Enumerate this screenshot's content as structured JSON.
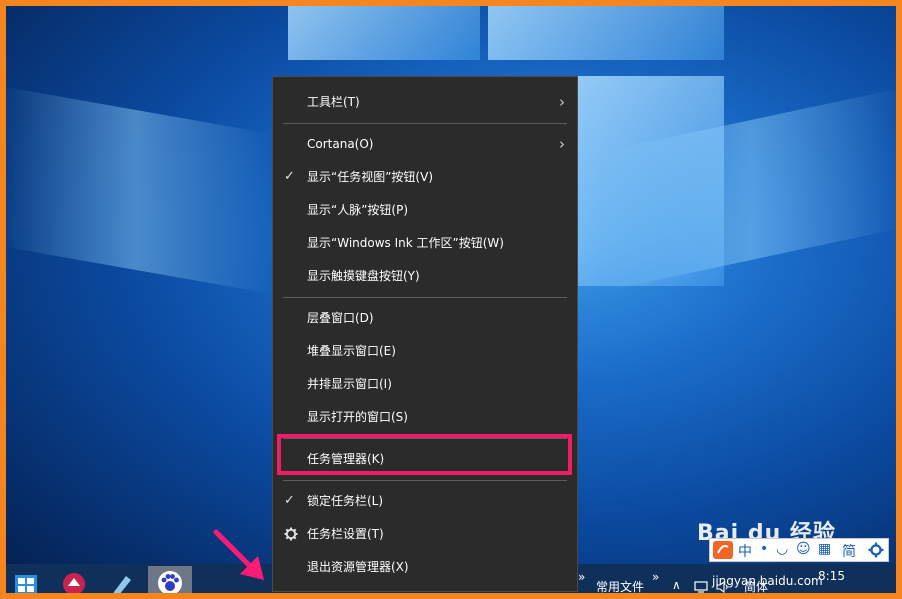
{
  "menu": {
    "items": [
      {
        "label": "工具栏(T)",
        "checked": false,
        "submenu": true
      },
      {
        "label": "Cortana(O)",
        "checked": false,
        "submenu": true
      },
      {
        "label": "显示“任务视图”按钮(V)",
        "checked": true,
        "submenu": false
      },
      {
        "label": "显示“人脉”按钮(P)",
        "checked": false,
        "submenu": false
      },
      {
        "label": "显示“Windows Ink 工作区”按钮(W)",
        "checked": false,
        "submenu": false
      },
      {
        "label": "显示触摸键盘按钮(Y)",
        "checked": false,
        "submenu": false
      },
      {
        "label": "层叠窗口(D)",
        "checked": false,
        "submenu": false
      },
      {
        "label": "堆叠显示窗口(E)",
        "checked": false,
        "submenu": false
      },
      {
        "label": "并排显示窗口(I)",
        "checked": false,
        "submenu": false
      },
      {
        "label": "显示打开的窗口(S)",
        "checked": false,
        "submenu": false
      },
      {
        "label": "任务管理器(K)",
        "checked": false,
        "submenu": false,
        "highlighted": true
      },
      {
        "label": "锁定任务栏(L)",
        "checked": true,
        "submenu": false
      },
      {
        "label": "任务栏设置(T)",
        "checked": false,
        "submenu": false,
        "icon": "gear-icon"
      },
      {
        "label": "退出资源管理器(X)",
        "checked": false,
        "submenu": false
      }
    ],
    "check_glyph": "✓",
    "chevron_glyph": "›"
  },
  "taskbar": {
    "toolbar_label": "常用文件",
    "toolbar_chevron": "»",
    "tray_expand": "∧",
    "ime_mode": "简体",
    "clock": "8:15"
  },
  "ime_bar": {
    "items": [
      "中",
      "•",
      "◡",
      "☺",
      "▦",
      "简"
    ]
  },
  "watermark": {
    "brand": "Bai du 经验",
    "url": "jingyan.baidu.com"
  },
  "colors": {
    "frame": "#f5861f",
    "highlight": "#ef1d67",
    "arrow": "#ff1a75",
    "menu_bg": "#2b2b2b"
  }
}
